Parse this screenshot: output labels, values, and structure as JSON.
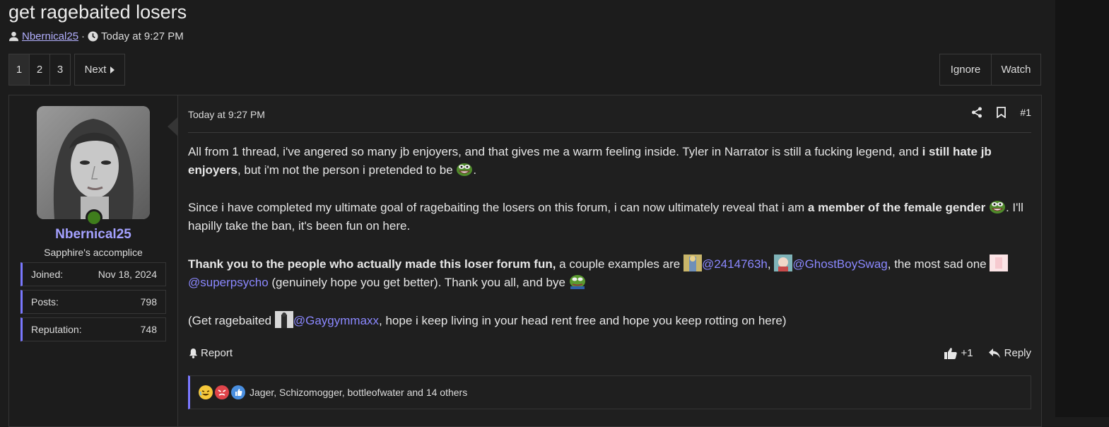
{
  "thread": {
    "title": "get ragebaited losers",
    "author": "Nbernical25",
    "separator": "·",
    "time": "Today at 9:27 PM"
  },
  "pagination": {
    "pages": [
      "1",
      "2",
      "3"
    ],
    "active_page": "1",
    "next_label": "Next"
  },
  "thread_actions": {
    "ignore_label": "Ignore",
    "watch_label": "Watch"
  },
  "user": {
    "name": "Nbernical25",
    "title": "Sapphire's accomplice",
    "online_color": "#3f7d1c",
    "stats": [
      {
        "label": "Joined:",
        "value": "Nov 18, 2024"
      },
      {
        "label": "Posts:",
        "value": "798"
      },
      {
        "label": "Reputation:",
        "value": "748"
      }
    ]
  },
  "post": {
    "date": "Today at 9:27 PM",
    "number": "#1",
    "p1": {
      "t1": "All from 1 thread, i've angered so many jb enjoyers, and that gives me a warm feeling inside. Tyler in Narrator is still a fucking legend, and ",
      "b1": "i still hate jb enjoyers",
      "t2": ", but i'm not the person i pretended to be ",
      "t3": "."
    },
    "p2": {
      "t1": "Since i have completed my ultimate goal of ragebaiting the losers on this forum, i can now ultimately reveal that i am ",
      "b1": "a member of the female gender",
      "t2": " ",
      "t3": ". I'll hapilly take the ban, it's been fun on here."
    },
    "p3": {
      "b1": "Thank you to the people who actually made this loser forum fun,",
      "t1": " a couple examples are ",
      "m1": "@2414763h",
      "t2": ", ",
      "m2": "@GhostBoySwag",
      "t3": ", the most sad one ",
      "m3": "@superpsycho",
      "t4": " (genuinely hope you get better). Thank you all, and bye "
    },
    "p4": {
      "t1": "(Get ragebaited ",
      "m1": "@Gaygymmaxx",
      "t2": ", hope i keep living in your head rent free and hope you keep rotting on here)"
    },
    "report_label": "Report",
    "like_count": "+1",
    "reply_label": "Reply",
    "reactions_text": "Jager, Schizomogger, bottleofwater and 14 others"
  },
  "colors": {
    "accent": "#7a78ff",
    "mention": "#8b88ff",
    "username": "#a4a1ff"
  },
  "icons": [
    "user-icon",
    "clock-icon",
    "caret-right-icon",
    "share-icon",
    "bookmark-icon",
    "bell-icon",
    "thumbs-up-icon",
    "reply-icon",
    "pepe-emoji",
    "laugh-reaction-icon",
    "angry-reaction-icon",
    "like-reaction-icon"
  ]
}
